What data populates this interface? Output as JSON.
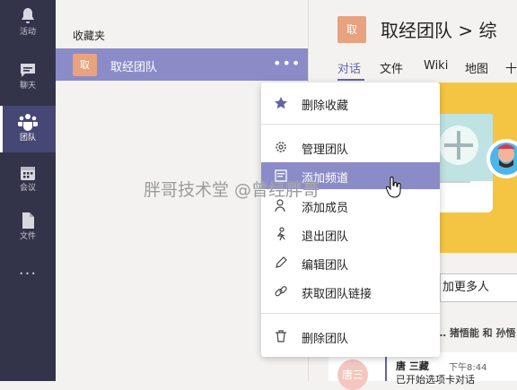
{
  "rail": {
    "items": [
      {
        "label": "活动",
        "icon": "bell-icon"
      },
      {
        "label": "聊天",
        "icon": "chat-icon"
      },
      {
        "label": "团队",
        "icon": "teams-icon"
      },
      {
        "label": "会议",
        "icon": "calendar-icon"
      },
      {
        "label": "文件",
        "icon": "file-icon"
      }
    ],
    "more": "..."
  },
  "list": {
    "heading": "收藏夹",
    "team": {
      "avatar": "取",
      "name": "取经团队",
      "more": "•••"
    }
  },
  "content": {
    "avatar": "取",
    "title": "取经团队 > 综",
    "tabs": [
      "对话",
      "文件",
      "Wiki",
      "地图",
      "十"
    ],
    "add_more": "加更多人",
    "mentions": "… 猪悟能 和 孙悟",
    "message": {
      "avatar": "唐三",
      "author": "唐 三藏",
      "time": "下午8:44",
      "preview": "已开始选项卡对话"
    }
  },
  "menu": {
    "items": [
      {
        "label": "删除收藏",
        "icon": "star-icon"
      },
      {
        "label": "管理团队",
        "icon": "gear-icon"
      },
      {
        "label": "添加频道",
        "icon": "channel-icon",
        "highlighted": true
      },
      {
        "label": "添加成员",
        "icon": "add-person-icon"
      },
      {
        "label": "退出团队",
        "icon": "leave-icon"
      },
      {
        "label": "编辑团队",
        "icon": "pencil-icon"
      },
      {
        "label": "获取团队链接",
        "icon": "link-icon"
      },
      {
        "label": "删除团队",
        "icon": "trash-icon"
      }
    ]
  },
  "watermark": "胖哥技术堂 @曾经胖哥",
  "colors": {
    "rail": "#33344a",
    "accent": "#6264a7",
    "highlight": "#8b8cc7",
    "avatar": "#e8a27f"
  }
}
